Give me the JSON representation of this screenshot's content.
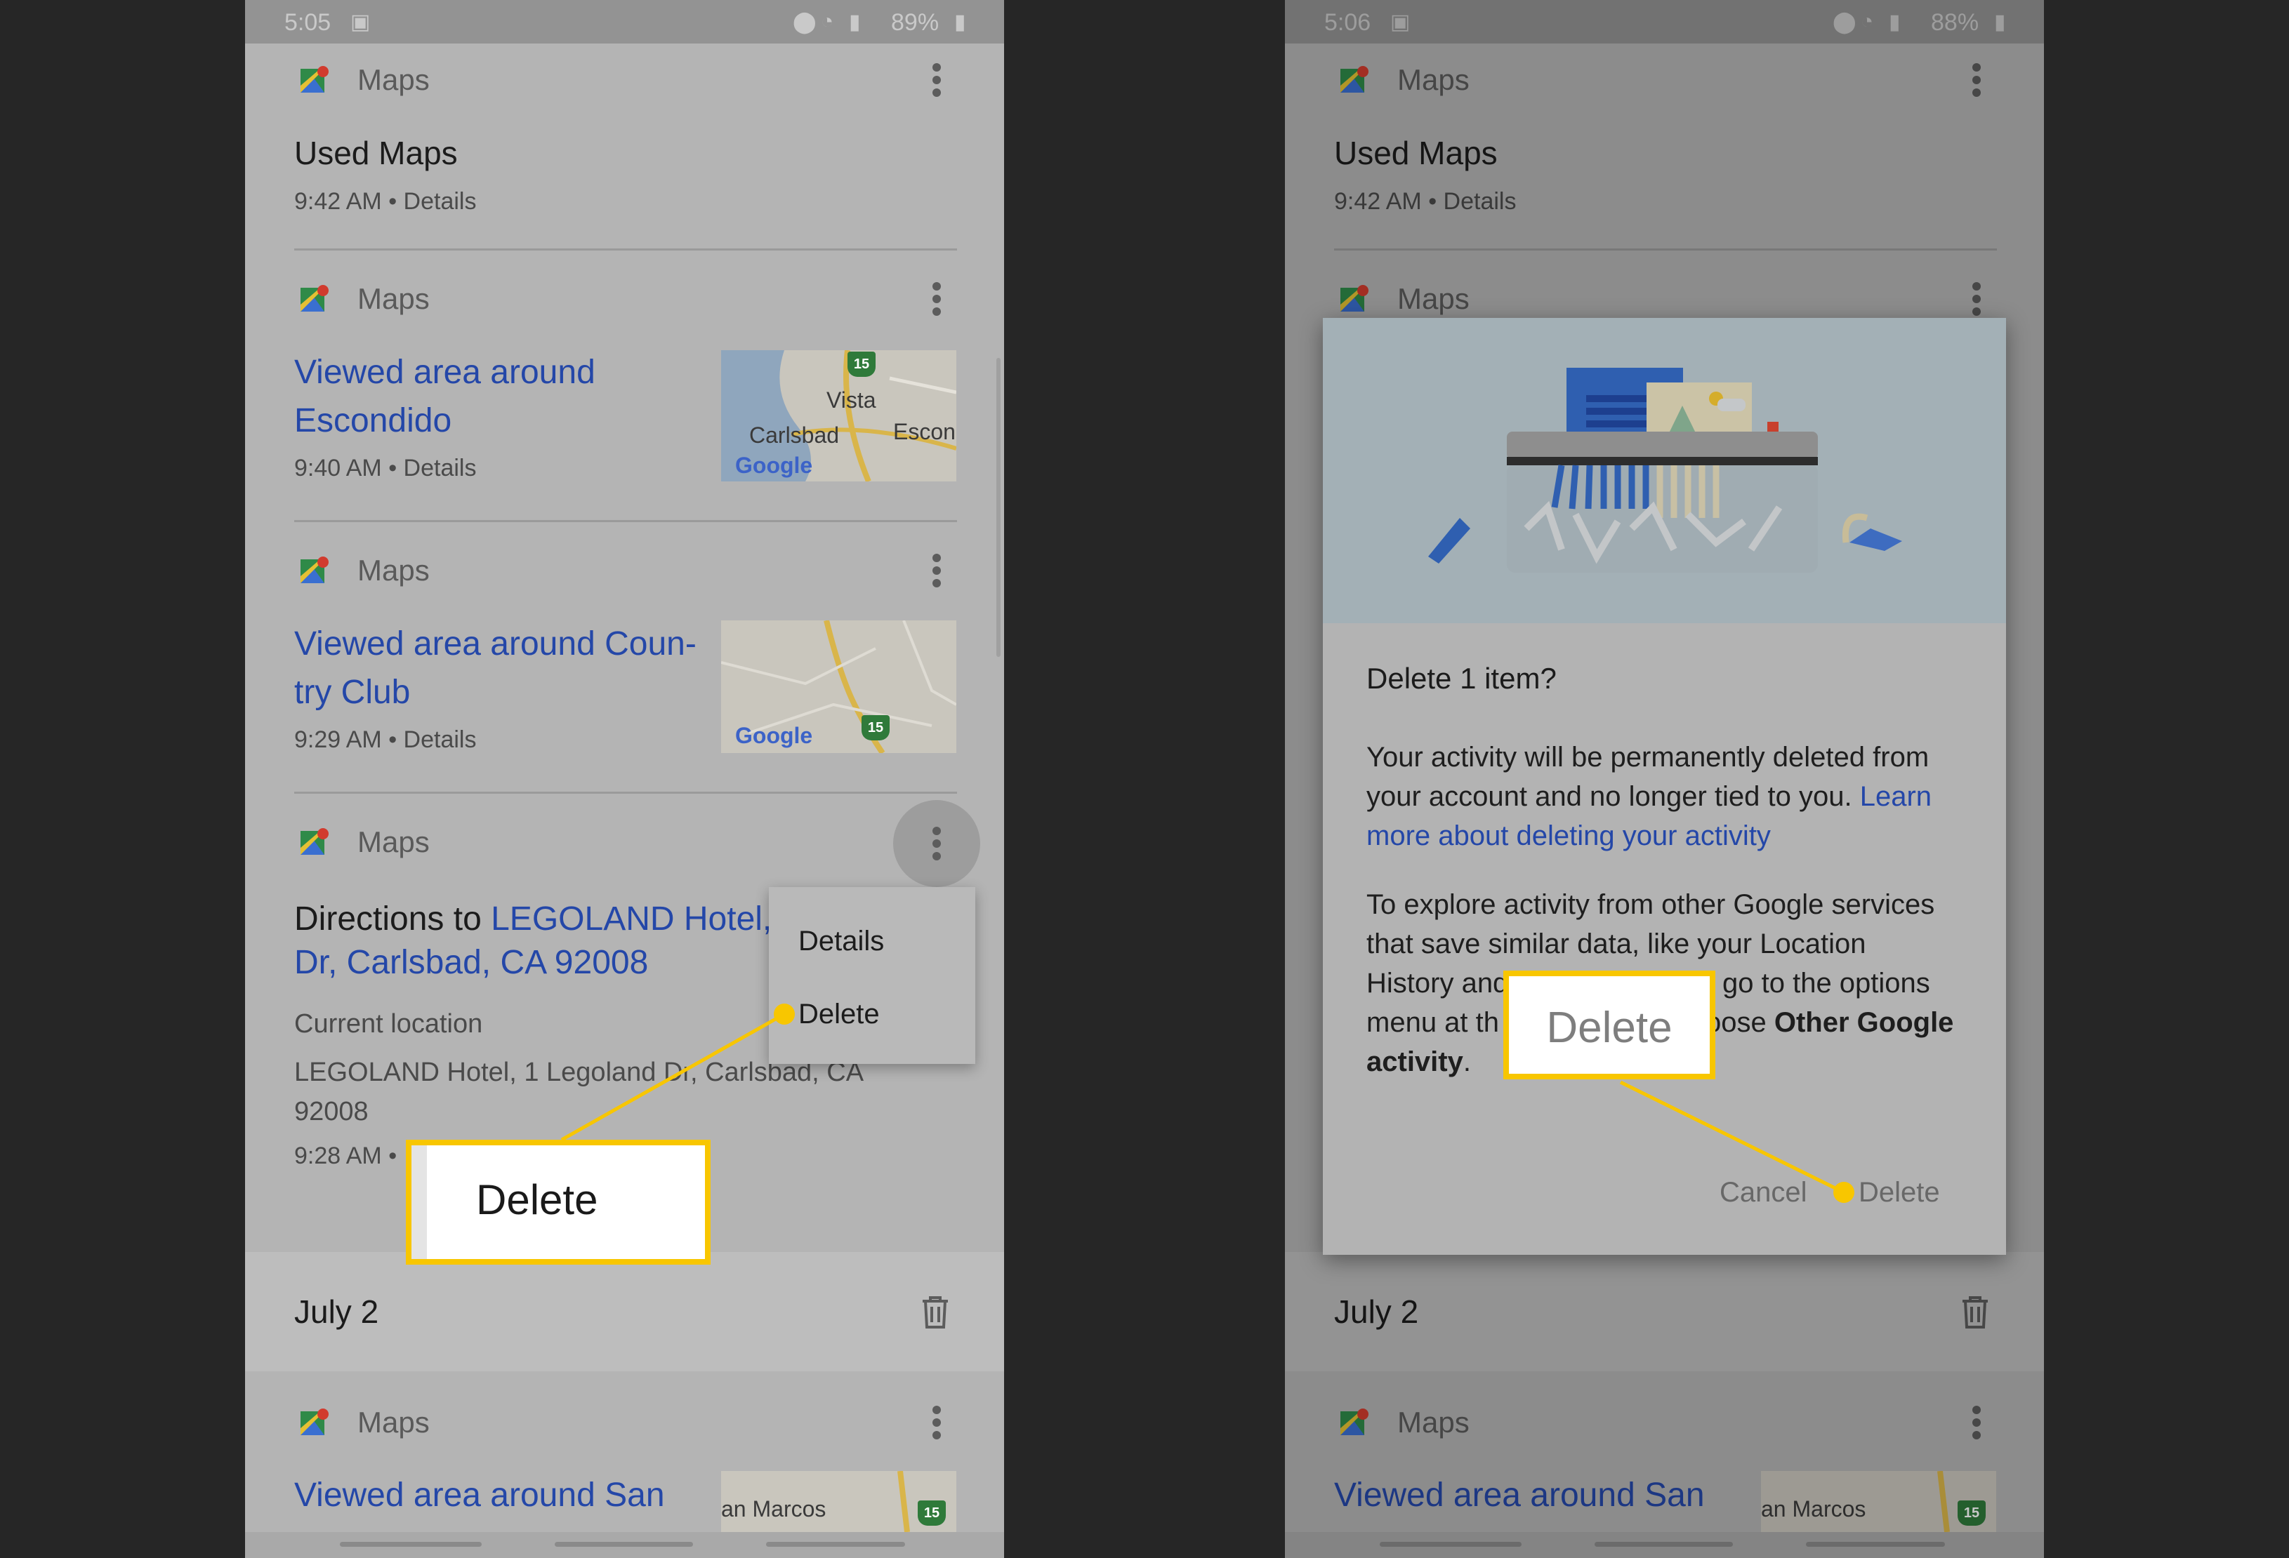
{
  "colors": {
    "background": "#262626",
    "accent_callout": "#f8c600",
    "link": "#2447a8"
  },
  "left": {
    "status": {
      "time": "5:05",
      "battery": "89%"
    },
    "entries": [
      {
        "app": "Maps",
        "title": "Used Maps",
        "meta": "9:42 AM • Details"
      },
      {
        "app": "Maps",
        "title_line1": "Viewed area around",
        "title_line2": "Escondido",
        "meta": "9:40 AM • Details",
        "map_labels": [
          "Vista",
          "Carlsbad",
          "Escon",
          "Google",
          "15"
        ]
      },
      {
        "app": "Maps",
        "title_line1": "Viewed area around Coun-",
        "title_line2": "try Club",
        "meta": "9:29 AM • Details",
        "map_labels": [
          "Google",
          "15"
        ]
      },
      {
        "app": "Maps",
        "title_prefix": "Directions to ",
        "title_link1": "LEGOLAND Hotel,",
        "title_link2": "Dr, Carlsbad, CA 92008",
        "origin": "Current location",
        "address_line1": "LEGOLAND Hotel, 1 Legoland Dr, Carlsbad, CA",
        "address_line2": "92008",
        "meta": "9:28 AM •"
      }
    ],
    "menu": {
      "items": [
        "Details",
        "Delete"
      ]
    },
    "section": {
      "date": "July 2"
    },
    "next_entry": {
      "app": "Maps",
      "title": "Viewed area around San",
      "map_labels": [
        "an Marcos",
        "15"
      ]
    },
    "callout": "Delete"
  },
  "right": {
    "status": {
      "time": "5:06",
      "battery": "88%"
    },
    "entries": [
      {
        "app": "Maps",
        "title": "Used Maps",
        "meta": "9:42 AM • Details"
      },
      {
        "app": "Maps"
      }
    ],
    "dialog": {
      "title": "Delete 1 item?",
      "p1_line1": "Your activity will be permanently deleted from",
      "p1_line2": "your account and no longer tied to you. ",
      "p1_link1": "Learn",
      "p1_link2": "more about deleting your activity",
      "p2_line1": "To explore activity from other Google services",
      "p2_line2": "that save similar data, like your Location",
      "p2_line3a": "History and",
      "p2_line3b": "go to the options",
      "p2_line4a": "menu at th",
      "p2_line4b": "oose ",
      "p2_line4c": "Other Google",
      "p2_line5a": "activity",
      "p2_line5b": ".",
      "cancel": "Cancel",
      "delete": "Delete"
    },
    "section": {
      "date": "July 2"
    },
    "next_entry": {
      "app": "Maps",
      "title": "Viewed area around San",
      "map_labels": [
        "an Marcos",
        "15"
      ]
    },
    "callout": "Delete"
  }
}
